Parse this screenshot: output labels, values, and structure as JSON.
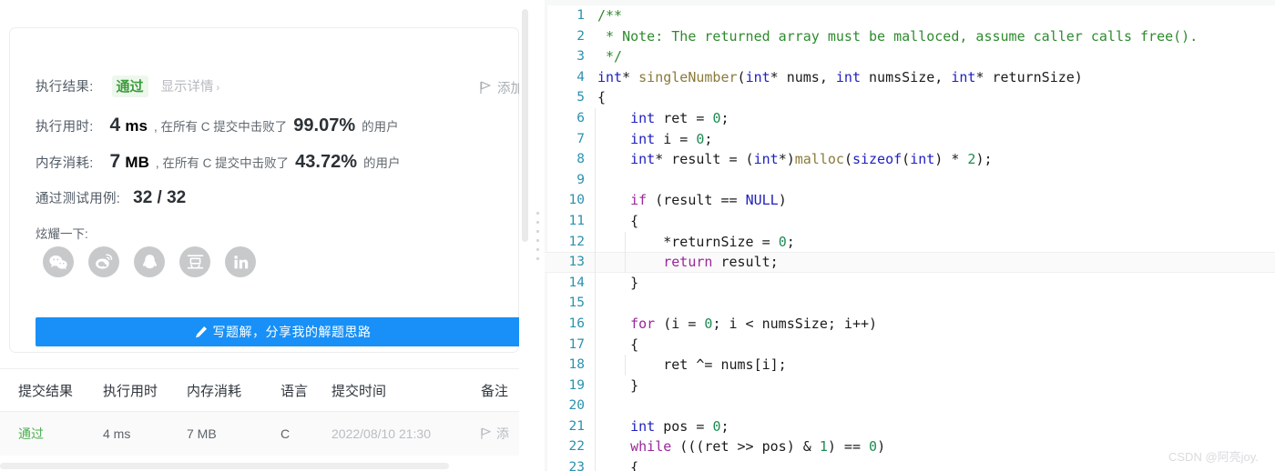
{
  "result_card": {
    "exec_result_label": "执行结果:",
    "status": "通过",
    "detail_link": "显示详情",
    "detail_chevron": "›",
    "add_note_label": "添加",
    "runtime_label": "执行用时:",
    "runtime_value": "4",
    "runtime_unit": "ms",
    "runtime_mid": ", 在所有 C 提交中击败了",
    "runtime_percent": "99.07%",
    "runtime_tail": "的用户",
    "memory_label": "内存消耗:",
    "memory_value": "7",
    "memory_unit": "MB",
    "memory_mid": ", 在所有 C 提交中击败了",
    "memory_percent": "43.72%",
    "memory_tail": "的用户",
    "cases_label": "通过测试用例:",
    "cases_value": "32 / 32",
    "flaunt_label": "炫耀一下:",
    "share_button": "写题解，分享我的解题思路",
    "socials": [
      {
        "name": "wechat-icon",
        "title": "微信"
      },
      {
        "name": "weibo-icon",
        "title": "微博"
      },
      {
        "name": "qq-icon",
        "title": "QQ"
      },
      {
        "name": "douban-icon",
        "title": "豆瓣"
      },
      {
        "name": "linkedin-icon",
        "title": "LinkedIn"
      }
    ]
  },
  "submissions_table": {
    "headers": [
      "提交结果",
      "执行用时",
      "内存消耗",
      "语言",
      "提交时间",
      "备注"
    ],
    "rows": [
      {
        "status": "通过",
        "runtime": "4 ms",
        "memory": "7 MB",
        "language": "C",
        "time": "2022/08/10 21:30",
        "note": "添"
      }
    ]
  },
  "code_editor": {
    "language": "C",
    "active_line": 13,
    "lines": [
      {
        "n": 1,
        "tokens": [
          {
            "t": "/**",
            "c": "cmt"
          }
        ],
        "indent": 0
      },
      {
        "n": 2,
        "tokens": [
          {
            "t": " * Note: The returned array must be malloced, assume caller calls free().",
            "c": "cmt"
          }
        ],
        "indent": 0
      },
      {
        "n": 3,
        "tokens": [
          {
            "t": " */",
            "c": "cmt"
          }
        ],
        "indent": 0
      },
      {
        "n": 4,
        "tokens": [
          {
            "t": "int",
            "c": "type"
          },
          {
            "t": "* ",
            "c": "p"
          },
          {
            "t": "singleNumber",
            "c": "fn"
          },
          {
            "t": "(",
            "c": "p"
          },
          {
            "t": "int",
            "c": "type"
          },
          {
            "t": "* nums, ",
            "c": "p"
          },
          {
            "t": "int",
            "c": "type"
          },
          {
            "t": " numsSize, ",
            "c": "p"
          },
          {
            "t": "int",
            "c": "type"
          },
          {
            "t": "* returnSize)",
            "c": "p"
          }
        ],
        "indent": 0
      },
      {
        "n": 5,
        "tokens": [
          {
            "t": "{",
            "c": "p"
          }
        ],
        "indent": 0
      },
      {
        "n": 6,
        "tokens": [
          {
            "t": "    ",
            "c": "p"
          },
          {
            "t": "int",
            "c": "type"
          },
          {
            "t": " ret = ",
            "c": "p"
          },
          {
            "t": "0",
            "c": "num"
          },
          {
            "t": ";",
            "c": "p"
          }
        ],
        "indent": 1
      },
      {
        "n": 7,
        "tokens": [
          {
            "t": "    ",
            "c": "p"
          },
          {
            "t": "int",
            "c": "type"
          },
          {
            "t": " i = ",
            "c": "p"
          },
          {
            "t": "0",
            "c": "num"
          },
          {
            "t": ";",
            "c": "p"
          }
        ],
        "indent": 1
      },
      {
        "n": 8,
        "tokens": [
          {
            "t": "    ",
            "c": "p"
          },
          {
            "t": "int",
            "c": "type"
          },
          {
            "t": "* result = (",
            "c": "p"
          },
          {
            "t": "int",
            "c": "type"
          },
          {
            "t": "*)",
            "c": "p"
          },
          {
            "t": "malloc",
            "c": "fn"
          },
          {
            "t": "(",
            "c": "p"
          },
          {
            "t": "sizeof",
            "c": "type"
          },
          {
            "t": "(",
            "c": "p"
          },
          {
            "t": "int",
            "c": "type"
          },
          {
            "t": ") * ",
            "c": "p"
          },
          {
            "t": "2",
            "c": "num"
          },
          {
            "t": ");",
            "c": "p"
          }
        ],
        "indent": 1
      },
      {
        "n": 9,
        "tokens": [],
        "indent": 1
      },
      {
        "n": 10,
        "tokens": [
          {
            "t": "    ",
            "c": "p"
          },
          {
            "t": "if",
            "c": "kw"
          },
          {
            "t": " (result == ",
            "c": "p"
          },
          {
            "t": "NULL",
            "c": "mac"
          },
          {
            "t": ")",
            "c": "p"
          }
        ],
        "indent": 1
      },
      {
        "n": 11,
        "tokens": [
          {
            "t": "    {",
            "c": "p"
          }
        ],
        "indent": 1
      },
      {
        "n": 12,
        "tokens": [
          {
            "t": "        *returnSize = ",
            "c": "p"
          },
          {
            "t": "0",
            "c": "num"
          },
          {
            "t": ";",
            "c": "p"
          }
        ],
        "indent": 2
      },
      {
        "n": 13,
        "tokens": [
          {
            "t": "        ",
            "c": "p"
          },
          {
            "t": "return",
            "c": "kw"
          },
          {
            "t": " result;",
            "c": "p"
          }
        ],
        "indent": 2
      },
      {
        "n": 14,
        "tokens": [
          {
            "t": "    }",
            "c": "p"
          }
        ],
        "indent": 1
      },
      {
        "n": 15,
        "tokens": [],
        "indent": 1
      },
      {
        "n": 16,
        "tokens": [
          {
            "t": "    ",
            "c": "p"
          },
          {
            "t": "for",
            "c": "kw"
          },
          {
            "t": " (i = ",
            "c": "p"
          },
          {
            "t": "0",
            "c": "num"
          },
          {
            "t": "; i < numsSize; i++)",
            "c": "p"
          }
        ],
        "indent": 1
      },
      {
        "n": 17,
        "tokens": [
          {
            "t": "    {",
            "c": "p"
          }
        ],
        "indent": 1
      },
      {
        "n": 18,
        "tokens": [
          {
            "t": "        ret ^= nums[i];",
            "c": "p"
          }
        ],
        "indent": 2
      },
      {
        "n": 19,
        "tokens": [
          {
            "t": "    }",
            "c": "p"
          }
        ],
        "indent": 1
      },
      {
        "n": 20,
        "tokens": [],
        "indent": 1
      },
      {
        "n": 21,
        "tokens": [
          {
            "t": "    ",
            "c": "p"
          },
          {
            "t": "int",
            "c": "type"
          },
          {
            "t": " pos = ",
            "c": "p"
          },
          {
            "t": "0",
            "c": "num"
          },
          {
            "t": ";",
            "c": "p"
          }
        ],
        "indent": 1
      },
      {
        "n": 22,
        "tokens": [
          {
            "t": "    ",
            "c": "p"
          },
          {
            "t": "while",
            "c": "kw"
          },
          {
            "t": " (((ret >> pos) & ",
            "c": "p"
          },
          {
            "t": "1",
            "c": "num"
          },
          {
            "t": ") == ",
            "c": "p"
          },
          {
            "t": "0",
            "c": "num"
          },
          {
            "t": ")",
            "c": "p"
          }
        ],
        "indent": 1
      },
      {
        "n": 23,
        "tokens": [
          {
            "t": "    {",
            "c": "p"
          }
        ],
        "indent": 1
      }
    ]
  },
  "watermark": "CSDN @阿亮joy.",
  "colors": {
    "accent_blue": "#1890f7",
    "pass_green": "#3c9c3c",
    "table_pass_green": "#4caf50",
    "keyword_purple": "#9b279b",
    "type_blue": "#2020c0",
    "comment_green": "#2e8b2e",
    "number_green": "#1e8a52",
    "function_tan": "#8a7a3b",
    "linenum_teal": "#2b91af"
  }
}
